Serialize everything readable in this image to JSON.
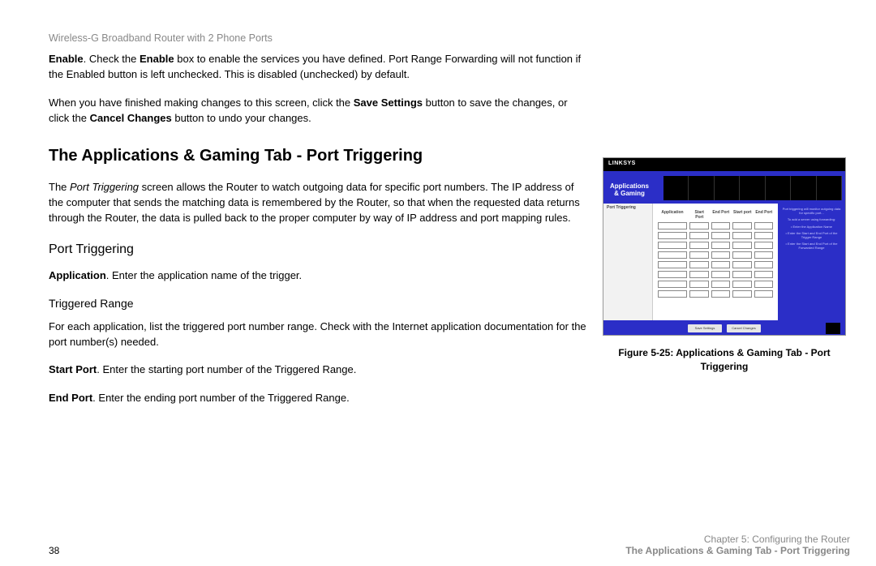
{
  "header": "Wireless-G Broadband Router with 2 Phone Ports",
  "intro": {
    "enable_bold": "Enable",
    "enable_text1": ". Check the ",
    "enable_text2": "Enable",
    "enable_text3": " box to enable the services you have defined. Port Range Forwarding will not function if the Enabled button is left unchecked. This is disabled (unchecked) by default.",
    "save_para1": "When you have finished making changes to this screen, click the ",
    "save_bold1": "Save Settings",
    "save_para2": " button to save the changes, or click the ",
    "save_bold2": "Cancel Changes",
    "save_para3": " button to undo your changes."
  },
  "section_title": "The Applications & Gaming Tab - Port Triggering",
  "port_desc": {
    "p1": "The ",
    "italic": "Port Triggering",
    "p2": " screen allows the Router to watch outgoing data for specific port numbers. The IP address of the computer that sends the matching data is remembered by the Router, so that when the requested data returns through the Router, the data is pulled back to the proper computer by way of IP address and port mapping rules."
  },
  "subsection": "Port Triggering",
  "application": {
    "bold": "Application",
    "text": ". Enter the application name of the trigger."
  },
  "triggered_range_heading": "Triggered Range",
  "triggered_desc": "For each application, list the triggered port number range. Check with the Internet application documentation for the port number(s) needed.",
  "start_port": {
    "bold": "Start Port",
    "text": ". Enter the starting port number of the Triggered Range."
  },
  "end_port": {
    "bold": "End Port",
    "text": ". Enter the ending port number of the Triggered Range."
  },
  "figure_caption": "Figure 5-25: Applications & Gaming Tab - Port Triggering",
  "thumb": {
    "pt_label": "Port Triggering",
    "hdr_app": "Application",
    "hdr_sp1": "Start Port",
    "hdr_ep1": "End Port",
    "hdr_sp2": "Start port",
    "hdr_ep2": "End Port",
    "btn_save": "Save Settings",
    "btn_cancel": "Cancel Changes"
  },
  "footer": {
    "page": "38",
    "chapter": "Chapter 5: Configuring the Router",
    "section": "The Applications & Gaming Tab - Port Triggering"
  }
}
